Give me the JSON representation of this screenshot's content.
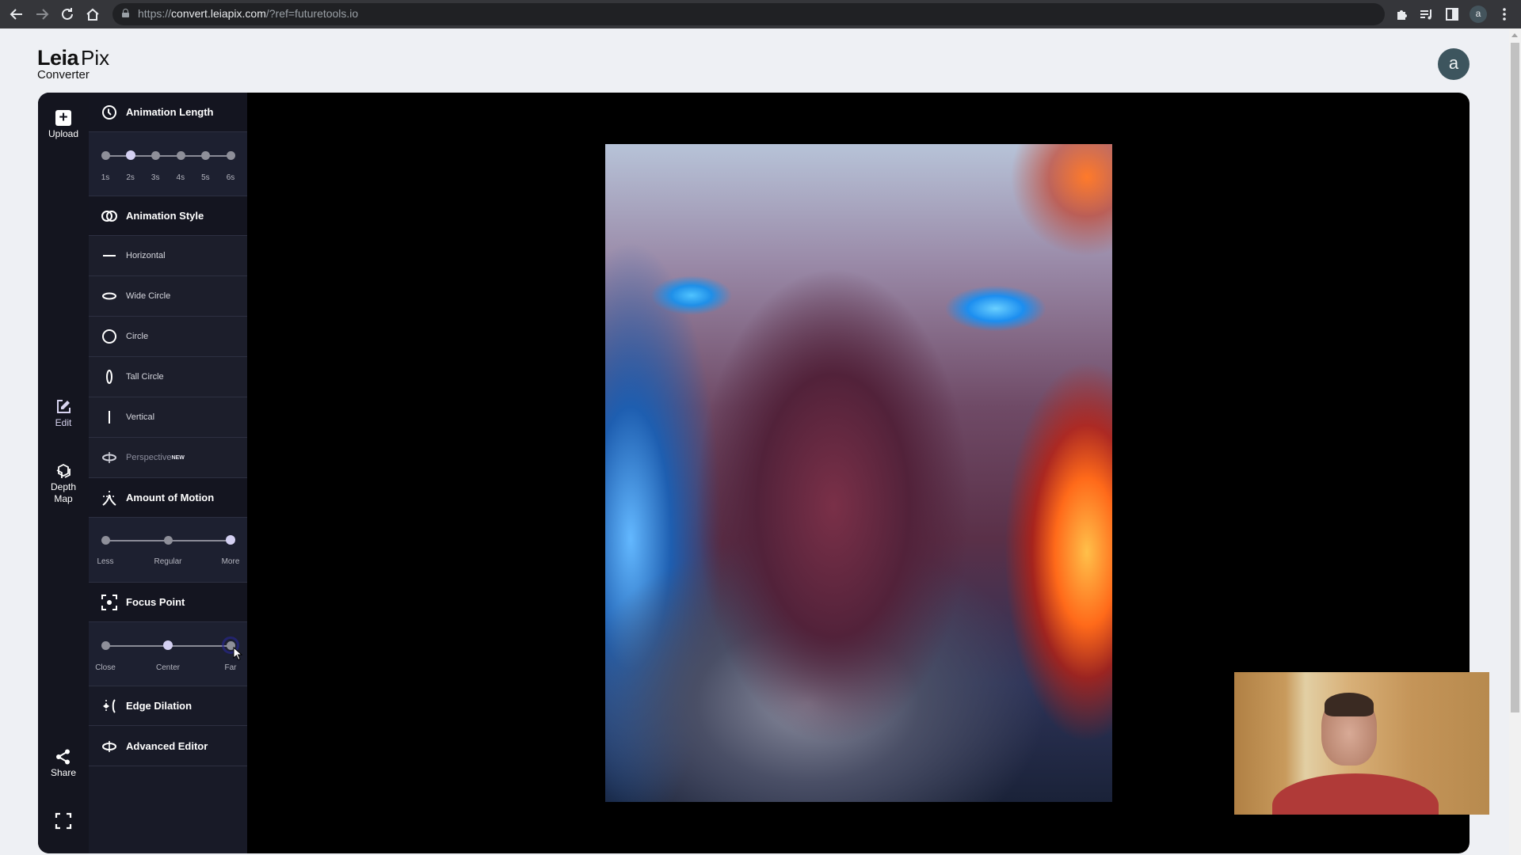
{
  "browser": {
    "url_scheme": "https://",
    "url_host": "convert.leiapix.com",
    "url_rest": "/?ref=futuretools.io",
    "profile_initial": "a"
  },
  "header": {
    "logo_primary": "Leia",
    "logo_secondary": "Pix",
    "logo_sub": "Converter",
    "avatar_initial": "a"
  },
  "rail": {
    "upload": "Upload",
    "edit": "Edit",
    "depth_map_line1": "Depth",
    "depth_map_line2": "Map",
    "share": "Share"
  },
  "panel": {
    "animation_length": {
      "title": "Animation Length",
      "options": [
        "1s",
        "2s",
        "3s",
        "4s",
        "5s",
        "6s"
      ],
      "selected": "2s"
    },
    "animation_style": {
      "title": "Animation Style",
      "options": [
        {
          "label": "Horizontal",
          "icon": "horizontal-line-icon"
        },
        {
          "label": "Wide Circle",
          "icon": "wide-ellipse-icon"
        },
        {
          "label": "Circle",
          "icon": "circle-icon"
        },
        {
          "label": "Tall Circle",
          "icon": "tall-ellipse-icon"
        },
        {
          "label": "Vertical",
          "icon": "vertical-line-icon"
        },
        {
          "label": "Perspective",
          "icon": "perspective-icon",
          "badge": "NEW"
        }
      ]
    },
    "amount_of_motion": {
      "title": "Amount of Motion",
      "options": [
        "Less",
        "Regular",
        "More"
      ],
      "selected": "More"
    },
    "focus_point": {
      "title": "Focus Point",
      "options": [
        "Close",
        "Center",
        "Far"
      ],
      "selected": "Center"
    },
    "edge_dilation": {
      "title": "Edge Dilation"
    },
    "advanced_editor": {
      "title": "Advanced Editor"
    }
  },
  "colors": {
    "rail_bg": "#14151f",
    "panel_bg": "#181a27",
    "slider_active": "#d4d0f2",
    "avatar_bg": "#3d555e"
  }
}
